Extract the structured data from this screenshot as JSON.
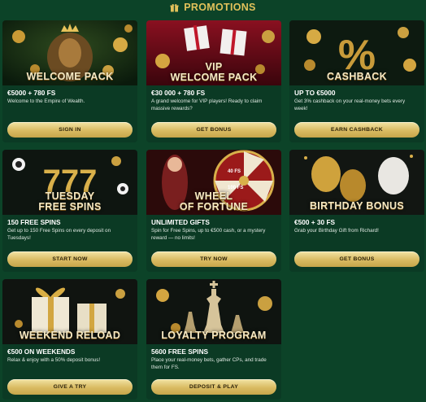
{
  "header": {
    "title": "PROMOTIONS",
    "icon": "gift-icon"
  },
  "colors": {
    "background": "#0c4328",
    "card": "#0b3a24",
    "accent_gold": "#e1c15a"
  },
  "promotions": [
    {
      "banner_title": "WELCOME PACK",
      "heading": "€5000 + 780 FS",
      "description": "Welcome to the Empire of Wealth.",
      "button": "SIGN IN"
    },
    {
      "banner_title_line1": "VIP",
      "banner_title": "WELCOME PACK",
      "heading": "€30 000 + 780 FS",
      "description": "A grand welcome for VIP players! Ready to claim massive rewards?",
      "button": "GET BONUS"
    },
    {
      "banner_title": "CASHBACK",
      "heading": "UP TO €5000",
      "description": "Get 3% cashback on your real-money bets every week!",
      "button": "EARN CASHBACK"
    },
    {
      "banner_title_line1": "TUESDAY",
      "banner_title": "FREE SPINS",
      "heading": "150 FREE SPINS",
      "description": "Get up to 150 Free Spins on every deposit on Tuesdays!",
      "button": "START NOW"
    },
    {
      "banner_title_line1": "WHEEL",
      "banner_title": "OF FORTUNE",
      "heading": "UNLIMITED GIFTS",
      "description": "Spin for Free Spins, up to €500 cash, or a mystery reward — no limits!",
      "button": "TRY NOW"
    },
    {
      "banner_title": "BIRTHDAY BONUS",
      "heading": "€500 + 30 FS",
      "description": "Grab your Birthday Gift from Richard!",
      "button": "GET BONUS"
    },
    {
      "banner_title": "WEEKEND RELOAD",
      "heading": "€500 ON WEEKENDS",
      "description": "Relax & enjoy with a 50% deposit bonus!",
      "button": "GIVE A TRY"
    },
    {
      "banner_title": "LOYALTY PROGRAM",
      "heading": "5600 FREE SPINS",
      "description": "Place your real-money bets, gather CPs, and trade them for FS.",
      "button": "DEPOSIT & PLAY"
    }
  ],
  "wheel_labels": [
    "40 FS",
    "100 FS"
  ]
}
